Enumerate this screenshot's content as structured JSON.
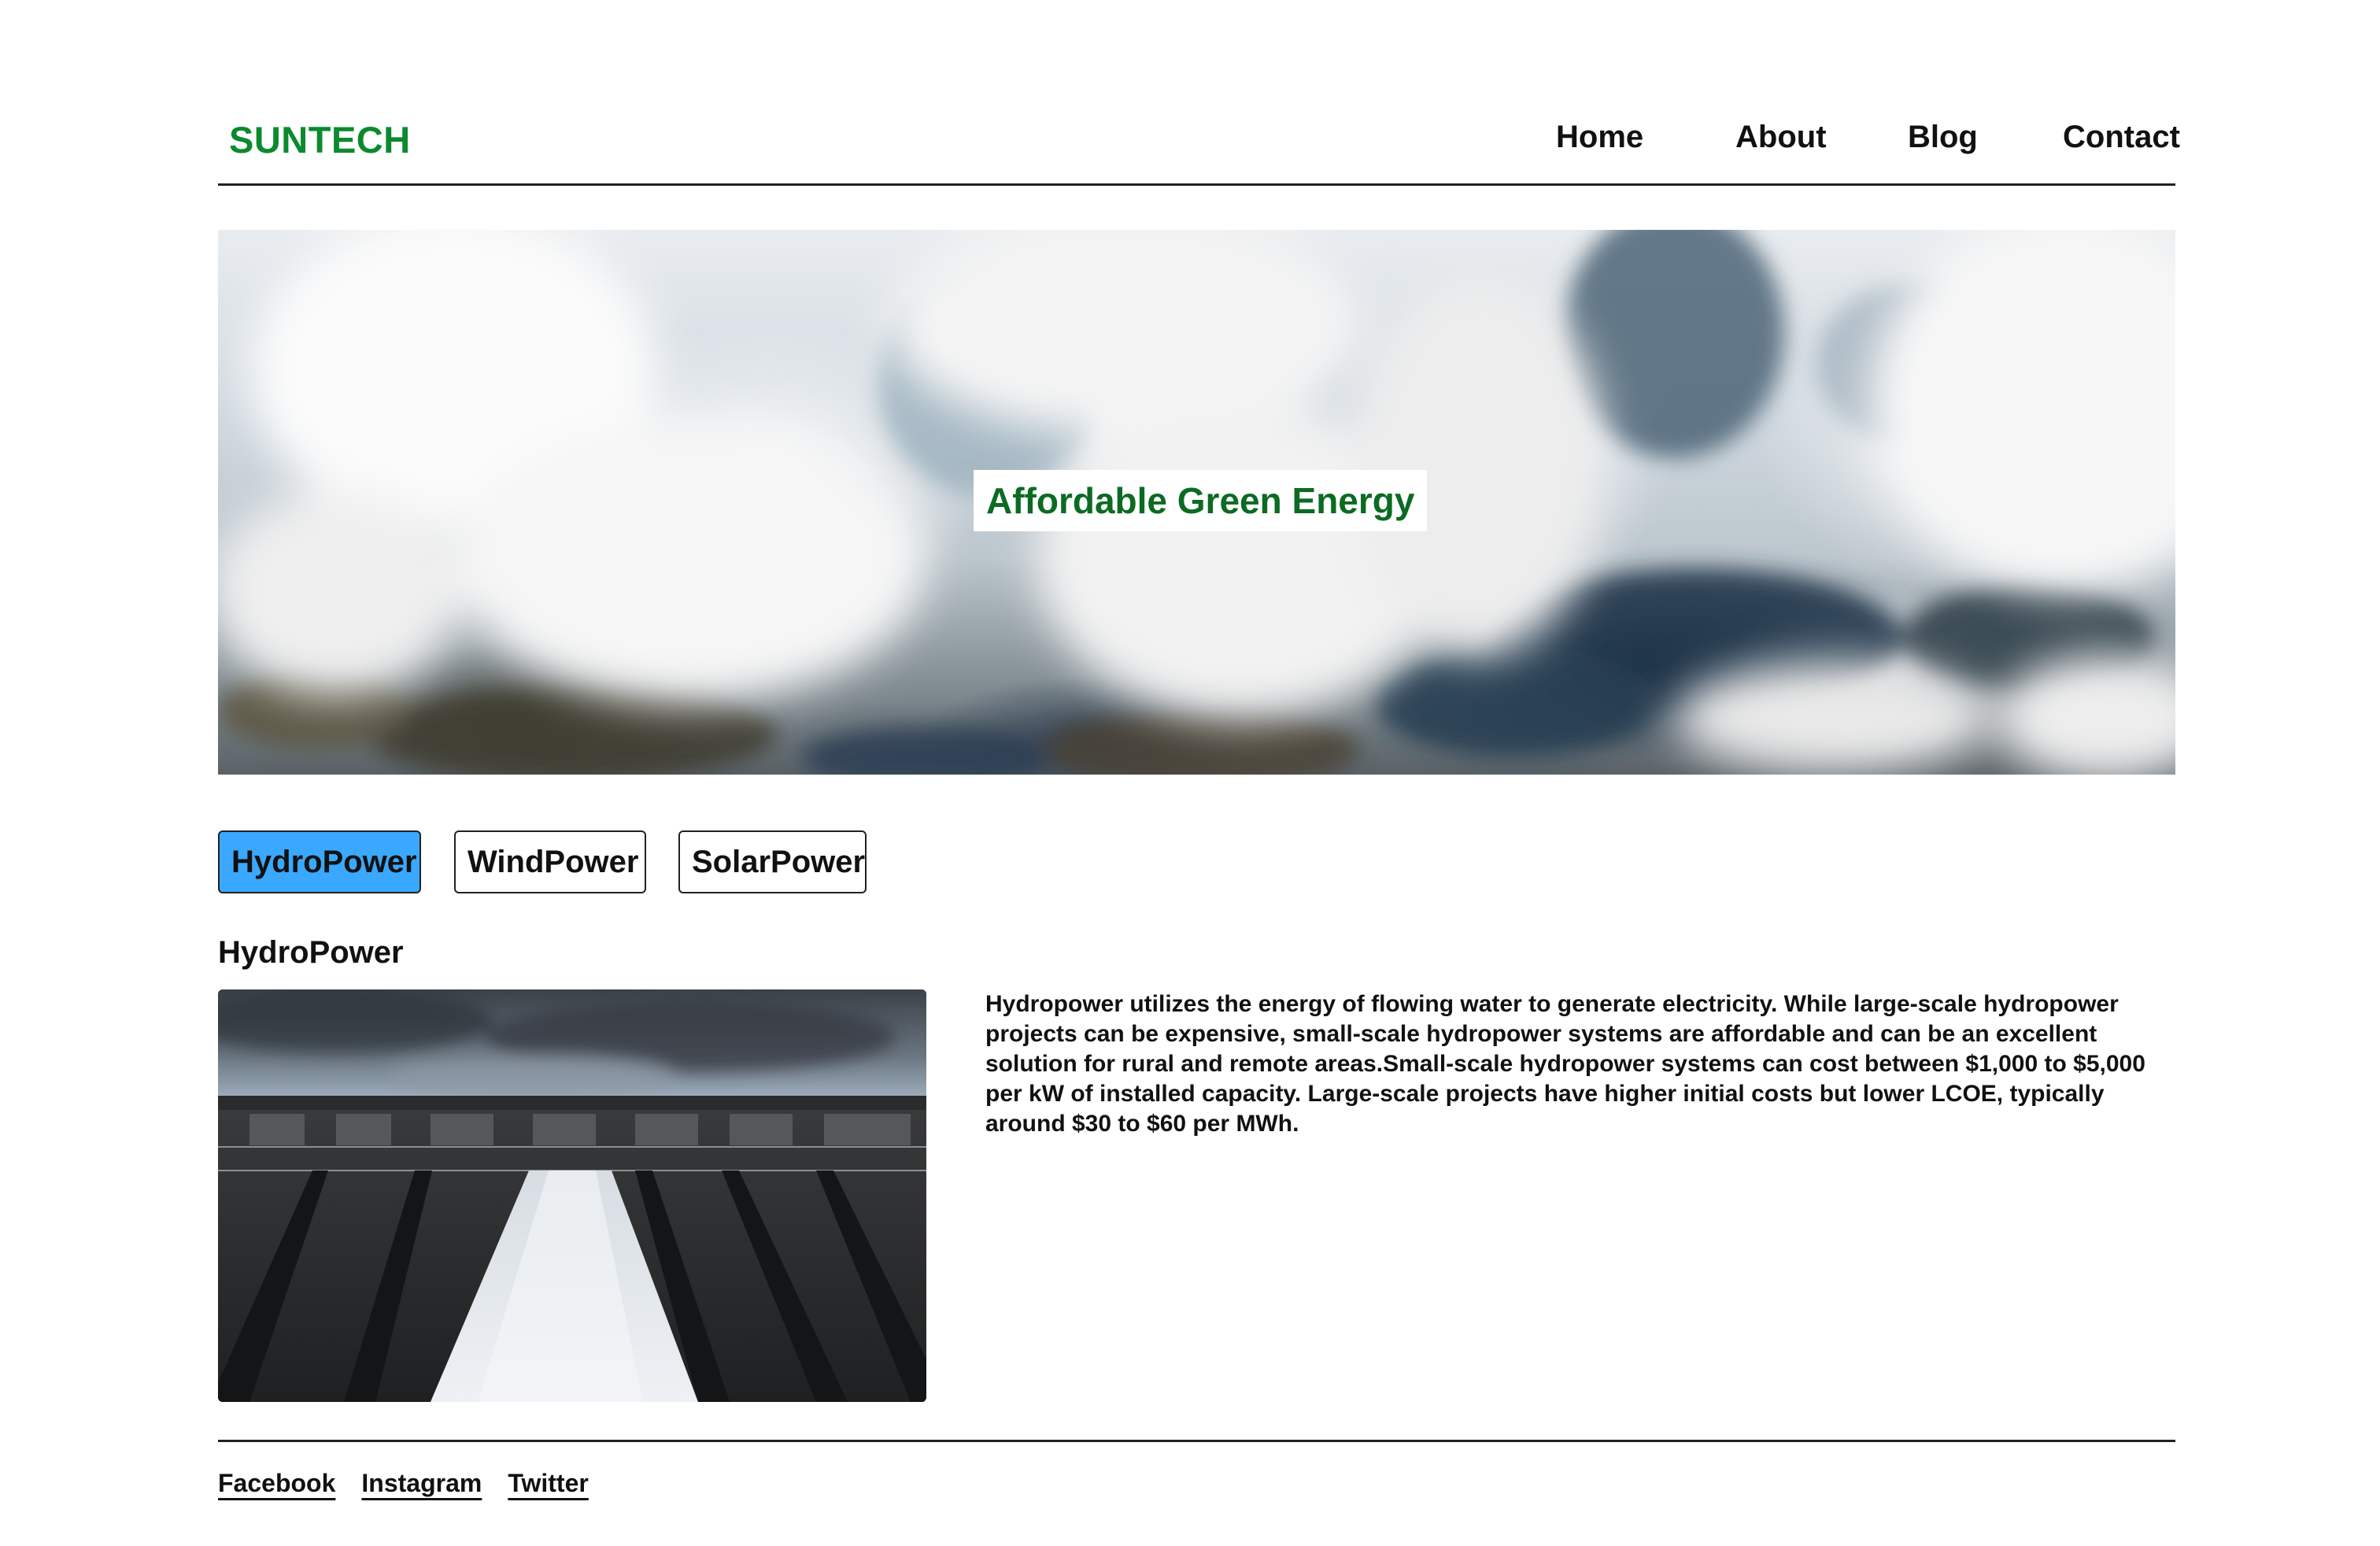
{
  "header": {
    "logo": "SUNTECH",
    "logo_color": "#0b8a2e",
    "nav": [
      "Home",
      "About",
      "Blog",
      "Contact"
    ]
  },
  "hero": {
    "caption": "Affordable Green Energy",
    "caption_color": "#0b6b22"
  },
  "tabs": {
    "items": [
      "HydroPower",
      "WindPower",
      "SolarPower"
    ],
    "active": "HydroPower",
    "active_color": "#3aa8ff"
  },
  "section": {
    "title": "HydroPower",
    "text": "Hydropower utilizes the energy of flowing water to generate electricity. While large-scale hydropower projects can be expensive, small-scale hydropower systems are affordable and can be an excellent solution for rural and remote areas.Small-scale hydropower systems can cost between $1,000 to $5,000 per kW of installed capacity. Large-scale projects have higher initial costs but lower LCOE, typically around $30 to $60 per MWh."
  },
  "footer": {
    "links": [
      "Facebook",
      "Instagram",
      "Twitter"
    ]
  }
}
